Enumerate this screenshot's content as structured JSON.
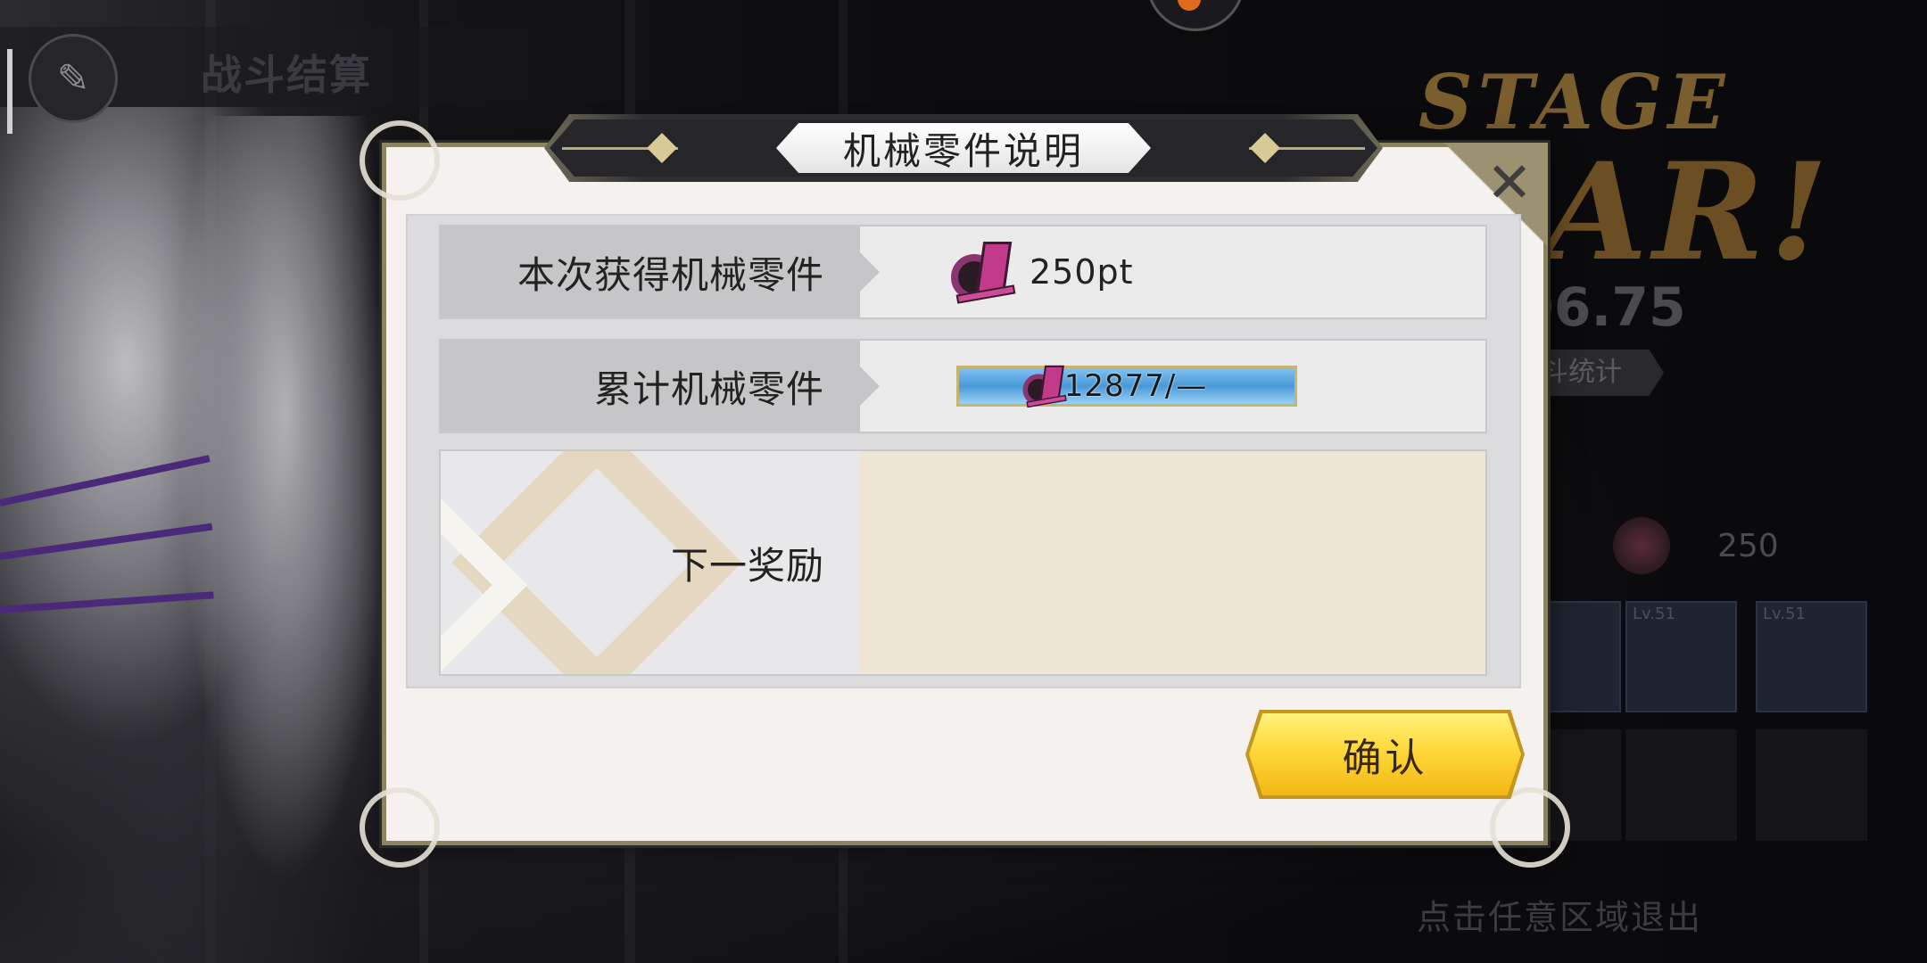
{
  "background": {
    "header_title": "战斗结算",
    "stage_text": "STAGE",
    "clear_text": "EAR!",
    "score": "06.75",
    "stats_button": "斗统计",
    "reward_count": "250",
    "item_cards": [
      {
        "level": "Lv.51"
      },
      {
        "level": "Lv.51"
      }
    ],
    "exit_hint": "点击任意区域退出"
  },
  "dialog": {
    "title": "机械零件说明",
    "close_label": "✕",
    "rows": [
      {
        "label": "本次获得机械零件",
        "value": "250pt"
      },
      {
        "label": "累计机械零件",
        "value": "12877/—"
      },
      {
        "label": "下一奖励",
        "value": ""
      }
    ],
    "confirm_label": "确认"
  },
  "colors": {
    "accent_gold": "#ffd83a",
    "progress_blue": "#4a98d8",
    "part_pink": "#c23a8a",
    "frame": "#8c8460"
  },
  "icons": {
    "mechanical_part": "mechanical-part-icon",
    "close": "close-icon"
  }
}
